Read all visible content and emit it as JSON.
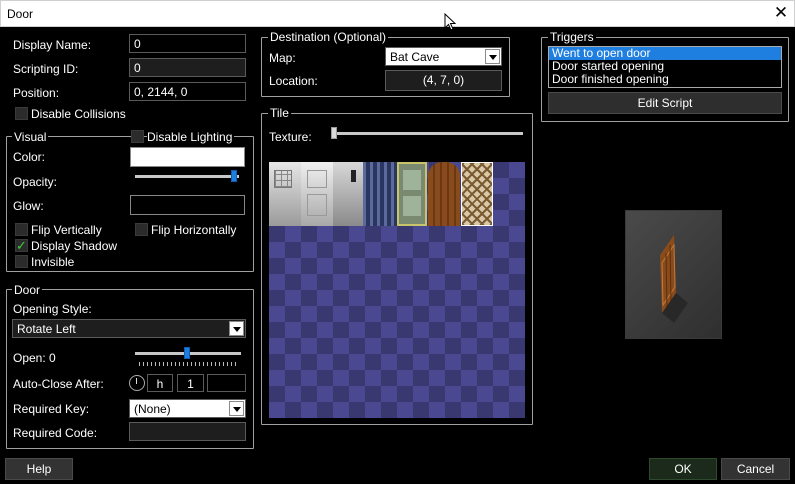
{
  "window": {
    "title": "Door",
    "close_glyph": "✕"
  },
  "general": {
    "display_name_label": "Display Name:",
    "display_name_value": "0",
    "scripting_id_label": "Scripting ID:",
    "scripting_id_value": "0",
    "position_label": "Position:",
    "position_value": "0, 2144, 0",
    "disable_collisions_label": "Disable Collisions",
    "disable_collisions_checked": false
  },
  "visual": {
    "legend": "Visual",
    "disable_lighting_label": "Disable Lighting",
    "color_label": "Color:",
    "color_value": "#ffffff",
    "opacity_label": "Opacity:",
    "opacity_level": 1.0,
    "glow_label": "Glow:",
    "glow_value": "#000000",
    "flip_vertically_label": "Flip Vertically",
    "flip_horizontally_label": "Flip Horizontally",
    "display_shadow_label": "Display Shadow",
    "display_shadow_checked": true,
    "invisible_label": "Invisible",
    "check_glyph": "✓"
  },
  "door": {
    "legend": "Door",
    "opening_style_label": "Opening Style:",
    "opening_style_value": "Rotate Left",
    "open_label": "Open: 0",
    "open_level": 0.5,
    "auto_close_label": "Auto-Close After:",
    "auto_close_h_label": "h",
    "auto_close_value": "1",
    "auto_close_extra": "",
    "required_key_label": "Required Key:",
    "required_key_value": "(None)",
    "required_code_label": "Required Code:",
    "required_code_value": ""
  },
  "destination": {
    "legend": "Destination (Optional)",
    "map_label": "Map:",
    "map_value": "Bat Cave",
    "location_label": "Location:",
    "location_value": "(4, 7, 0)"
  },
  "tile": {
    "legend": "Tile",
    "texture_label": "Texture:",
    "texture_level": 0.0
  },
  "triggers": {
    "legend": "Triggers",
    "items": [
      "Went to open door",
      "Door started opening",
      "Door finished opening"
    ],
    "selected_index": 0,
    "edit_script_label": "Edit Script"
  },
  "footer": {
    "help_label": "Help",
    "ok_label": "OK",
    "cancel_label": "Cancel"
  },
  "colors": {
    "accent": "#1f7fe0",
    "checker_dark": "#3a3870",
    "checker_light": "#4a4890"
  }
}
